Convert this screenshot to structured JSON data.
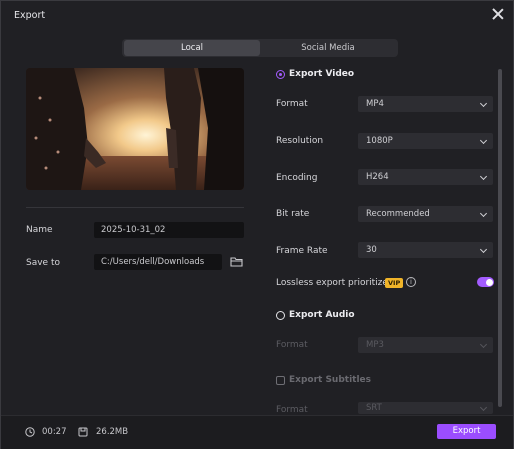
{
  "window": {
    "title": "Export"
  },
  "tabs": [
    {
      "label": "Local",
      "active": true
    },
    {
      "label": "Social Media",
      "active": false
    }
  ],
  "left": {
    "name_label": "Name",
    "name_value": "2025-10-31_02",
    "save_label": "Save to",
    "save_path": "C:/Users/dell/Downloads"
  },
  "video": {
    "title": "Export Video",
    "selected": true,
    "format_label": "Format",
    "format_value": "MP4",
    "resolution_label": "Resolution",
    "resolution_value": "1080P",
    "encoding_label": "Encoding",
    "encoding_value": "H264",
    "bitrate_label": "Bit rate",
    "bitrate_value": "Recommended",
    "framerate_label": "Frame Rate",
    "framerate_value": "30",
    "lossless_label": "Lossless export prioritized",
    "vip_badge": "VIP",
    "info_glyph": "i",
    "lossless_on": true
  },
  "audio": {
    "title": "Export Audio",
    "selected": false,
    "format_label": "Format",
    "format_value": "MP3"
  },
  "subtitles": {
    "title": "Export Subtitles",
    "checked": false,
    "format_label": "Format",
    "format_value": "SRT"
  },
  "footer": {
    "duration": "00:27",
    "size": "26.2MB",
    "export_label": "Export"
  },
  "colors": {
    "accent": "#9b4dff",
    "vip": "#f0b429",
    "background": "#202024"
  }
}
